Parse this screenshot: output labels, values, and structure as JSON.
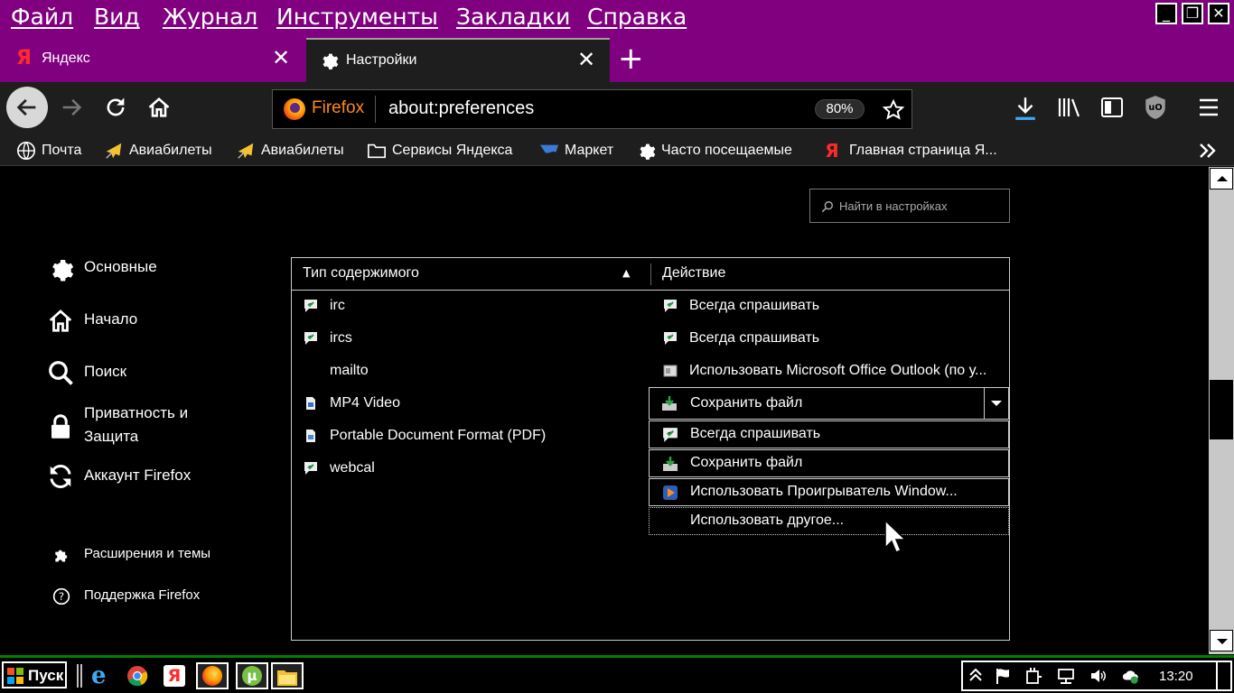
{
  "menu": {
    "items": [
      "Файл",
      "Вид",
      "Журнал",
      "Инструменты",
      "Закладки",
      "Справка"
    ]
  },
  "window_controls": {
    "minimize": "_",
    "maximize": "❐",
    "close": "✕"
  },
  "tabs": [
    {
      "label": "Яндекс",
      "icon": "yandex-icon",
      "active": false
    },
    {
      "label": "Настройки",
      "icon": "gear-icon",
      "active": true
    }
  ],
  "urlbar": {
    "identity": "Firefox",
    "url": "about:preferences",
    "zoom": "80%"
  },
  "bookmarks": [
    {
      "label": "Почта",
      "icon": "globe-icon"
    },
    {
      "label": "Авиабилеты",
      "icon": "plane-icon"
    },
    {
      "label": "Авиабилеты",
      "icon": "plane-icon"
    },
    {
      "label": "Сервисы Яндекса",
      "icon": "folder-icon"
    },
    {
      "label": "Маркет",
      "icon": "market-icon"
    },
    {
      "label": "Часто посещаемые",
      "icon": "gear-icon"
    },
    {
      "label": "Главная страница Я...",
      "icon": "yandex-icon"
    }
  ],
  "settings": {
    "search_placeholder": "Найти в настройках",
    "categories": [
      {
        "label": "Основные",
        "icon": "gear-icon"
      },
      {
        "label": "Начало",
        "icon": "home-icon"
      },
      {
        "label": "Поиск",
        "icon": "search-icon"
      },
      {
        "label": "Приватность и Защита",
        "icon": "lock-icon"
      },
      {
        "label": "Аккаунт Firefox",
        "icon": "sync-icon"
      }
    ],
    "footer_links": [
      {
        "label": "Расширения и темы",
        "icon": "puzzle-icon"
      },
      {
        "label": "Поддержка Firefox",
        "icon": "help-icon"
      }
    ]
  },
  "applications": {
    "columns": [
      "Тип содержимого",
      "Действие"
    ],
    "sort_indicator": "▲",
    "rows": [
      {
        "type": "irc",
        "type_icon": "chat-icon",
        "action": "Всегда спрашивать",
        "action_icon": "chat-icon"
      },
      {
        "type": "ircs",
        "type_icon": "chat-icon",
        "action": "Всегда спрашивать",
        "action_icon": "chat-icon"
      },
      {
        "type": "mailto",
        "type_icon": "",
        "action": "Использовать Microsoft Office Outlook (по у...",
        "action_icon": "outlook-icon"
      },
      {
        "type": "MP4 Video",
        "type_icon": "video-file-icon",
        "action": "Сохранить файл",
        "action_icon": "save-icon"
      },
      {
        "type": "Portable Document Format (PDF)",
        "type_icon": "pdf-file-icon",
        "action": "",
        "action_icon": ""
      },
      {
        "type": "webcal",
        "type_icon": "chat-icon",
        "action": "",
        "action_icon": ""
      }
    ],
    "dropdown": {
      "selected": "Сохранить файл",
      "options": [
        {
          "label": "Всегда спрашивать",
          "icon": "chat-icon"
        },
        {
          "label": "Сохранить файл",
          "icon": "save-icon"
        },
        {
          "label": "Использовать Проигрыватель Window...",
          "icon": "media-player-icon"
        },
        {
          "label": "Использовать другое...",
          "icon": ""
        }
      ]
    }
  },
  "taskbar": {
    "start_label": "Пуск",
    "apps": [
      "ie-icon",
      "chrome-icon",
      "yandex-browser-icon",
      "firefox-icon",
      "utorrent-icon",
      "explorer-icon"
    ],
    "clock": "13:20"
  },
  "colors": {
    "menubar_bg": "#800080",
    "toolbar_bg": "#1e1e1e",
    "content_bg": "#000000",
    "taskbar_border": "#008000",
    "firefox_orange": "#ff8a1f",
    "download_blue": "#3fa9f5"
  }
}
